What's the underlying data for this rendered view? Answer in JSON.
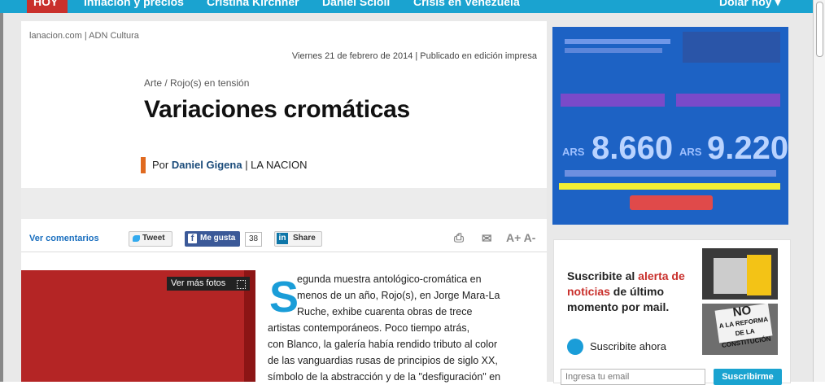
{
  "topnav": {
    "items": [
      "HOY",
      "Inflación y precios",
      "Cristina Kirchner",
      "Daniel Scioli",
      "Crisis en Venezuela"
    ],
    "right": "Dólar hoy ▾"
  },
  "article": {
    "breadcrumb": "lanacion.com | ADN Cultura",
    "date": "Viernes 21 de febrero de 2014 | Publicado en edición impresa",
    "kicker": "Arte / Rojo(s) en tensión",
    "headline": "Variaciones cromáticas",
    "by_prefix": "Por",
    "author": "Daniel Gigena",
    "outlet": "| LA NACION",
    "dropcap": "S",
    "lines": [
      "egunda muestra antológico-cromática en",
      "menos de un año, Rojo(s), en Jorge Mara-La",
      "Ruche, exhibe cuarenta obras de trece",
      "artistas contemporáneos. Poco tiempo atrás,",
      "con Blanco, la galería había rendido tributo al color",
      "de las vanguardias rusas de principios de siglo XX,",
      "símbolo de la abstracción y de la \"desfiguración\" en"
    ]
  },
  "sharebar": {
    "comments": "Ver comentarios",
    "tweet": "Tweet",
    "like": "Me gusta",
    "like_count": "38",
    "share": "Share",
    "font_controls": "A+ A-"
  },
  "photo": {
    "more_photos": "Ver más fotos"
  },
  "newsletter": {
    "title_a": "Suscribite al ",
    "title_red": "alerta de noticias",
    "title_b": " de último momento por mail.",
    "subscribe_now": "Suscribite ahora",
    "email_placeholder": "Ingresa tu email",
    "subscribe_button": "Suscribirme",
    "thumb2_sign_top": "NO",
    "thumb2_sign_text": "A LA REFORMA DE LA CONSTITUCIÓN"
  },
  "ad": {
    "currency": "ARS",
    "value1": "8.660",
    "value2": "9.220"
  },
  "colors": {
    "accent": "#1aa3d0",
    "red": "#c9302c",
    "byline_bar": "#e06a20"
  }
}
